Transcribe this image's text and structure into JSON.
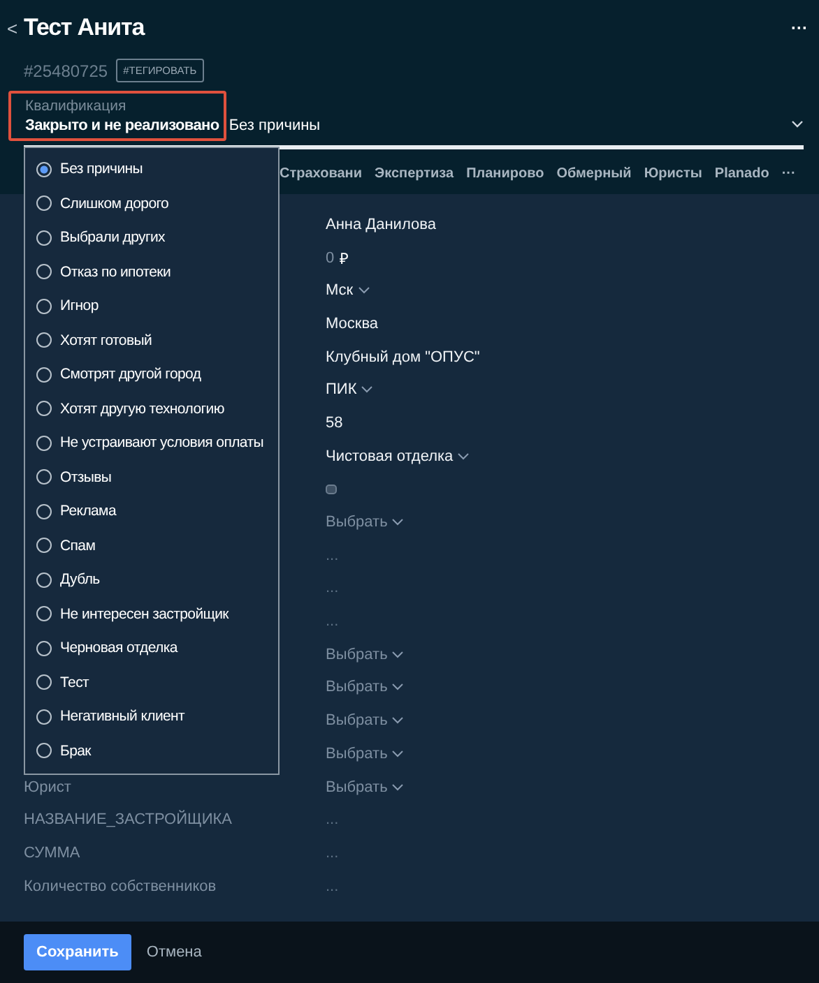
{
  "header": {
    "back": "<",
    "title": "Тест Анита",
    "more": "···",
    "id": "#25480725",
    "tag_button": "#ТЕГИРОВАТЬ"
  },
  "qualification": {
    "label": "Квалификация",
    "status": "Закрыто и не реализовано",
    "reason": "Без причины",
    "highlighted": true
  },
  "tabs": [
    {
      "label": "Страховани"
    },
    {
      "label": "Экспертиза"
    },
    {
      "label": "Планирово"
    },
    {
      "label": "Обмерный"
    },
    {
      "label": "Юристы"
    },
    {
      "label": "Planado"
    }
  ],
  "tabs_more": "···",
  "fields": [
    {
      "kind": "text",
      "value": "Анна Данилова"
    },
    {
      "kind": "money",
      "value": "0",
      "currency": "₽"
    },
    {
      "kind": "select",
      "value": "Мск"
    },
    {
      "kind": "text",
      "value": "Москва"
    },
    {
      "kind": "text",
      "value": "Клубный дом \"ОПУС\""
    },
    {
      "kind": "select",
      "value": "ПИК"
    },
    {
      "kind": "text",
      "value": "58"
    },
    {
      "kind": "select",
      "value": "Чистовая отделка"
    },
    {
      "kind": "icon"
    },
    {
      "kind": "placeholder",
      "value": "Выбрать"
    },
    {
      "kind": "empty",
      "value": "..."
    },
    {
      "kind": "empty",
      "value": "..."
    },
    {
      "kind": "empty",
      "value": "..."
    },
    {
      "kind": "placeholder",
      "value": "Выбрать"
    },
    {
      "kind": "placeholder",
      "value": "Выбрать"
    },
    {
      "kind": "placeholder",
      "value": "Выбрать"
    },
    {
      "kind": "placeholder",
      "value": "Выбрать"
    },
    {
      "kind": "placeholder",
      "label": "Юрист",
      "value": "Выбрать"
    },
    {
      "kind": "empty",
      "label": "НАЗВАНИЕ_ЗАСТРОЙЩИКА",
      "value": "..."
    },
    {
      "kind": "empty",
      "label": "СУММА",
      "value": "..."
    },
    {
      "kind": "empty",
      "label": "Количество собственников",
      "value": "..."
    }
  ],
  "reasons": [
    {
      "label": "Без причины",
      "selected": true
    },
    {
      "label": "Слишком дорого",
      "selected": false
    },
    {
      "label": "Выбрали других",
      "selected": false
    },
    {
      "label": "Отказ по ипотеки",
      "selected": false
    },
    {
      "label": "Игнор",
      "selected": false
    },
    {
      "label": "Хотят готовый",
      "selected": false
    },
    {
      "label": "Смотрят другой город",
      "selected": false
    },
    {
      "label": "Хотят другую технологию",
      "selected": false
    },
    {
      "label": "Не устраивают условия оплаты",
      "selected": false
    },
    {
      "label": "Отзывы",
      "selected": false
    },
    {
      "label": "Реклама",
      "selected": false
    },
    {
      "label": "Спам",
      "selected": false
    },
    {
      "label": "Дубль",
      "selected": false
    },
    {
      "label": "Не интересен застройщик",
      "selected": false
    },
    {
      "label": "Черновая отделка",
      "selected": false
    },
    {
      "label": "Тест",
      "selected": false
    },
    {
      "label": "Негативный клиент",
      "selected": false
    },
    {
      "label": "Брак",
      "selected": false
    }
  ],
  "footer": {
    "save": "Сохранить",
    "cancel": "Отмена"
  }
}
